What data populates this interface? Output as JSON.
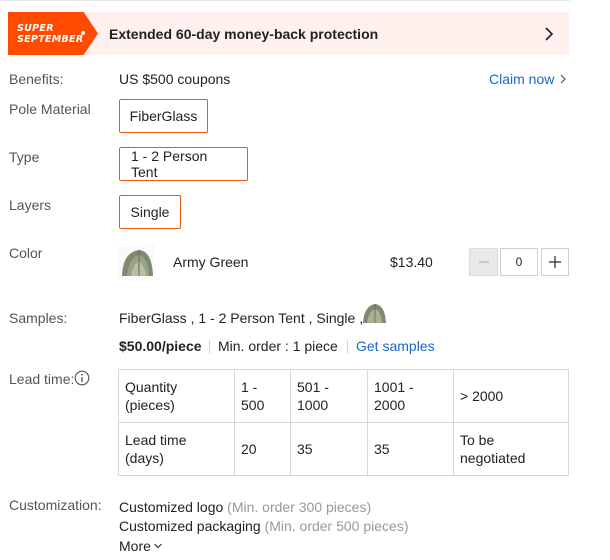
{
  "banner": {
    "badge_line1": "SUPER",
    "badge_line2": "SEPTEMBER",
    "text": "Extended 60-day money-back protection"
  },
  "benefits": {
    "label": "Benefits:",
    "value": "US $500 coupons",
    "claim_label": "Claim now"
  },
  "pole_material": {
    "label": "Pole Material",
    "selected": "FiberGlass"
  },
  "type": {
    "label": "Type",
    "selected": "1 - 2 Person Tent"
  },
  "layers": {
    "label": "Layers",
    "selected": "Single"
  },
  "color": {
    "label": "Color",
    "name": "Army Green",
    "price": "$13.40",
    "quantity": "0"
  },
  "samples": {
    "label": "Samples:",
    "summary": "FiberGlass , 1 - 2 Person Tent , Single ,",
    "price": "$50.00/piece",
    "min_order": "Min. order : 1 piece",
    "get_samples": "Get samples"
  },
  "lead_time": {
    "label": "Lead time:",
    "row1": [
      "Quantity (pieces)",
      "1 - 500",
      "501 - 1000",
      "1001 - 2000",
      "> 2000"
    ],
    "row2": [
      "Lead time (days)",
      "20",
      "35",
      "35",
      "To be negotiated"
    ]
  },
  "customization": {
    "label": "Customization:",
    "items": [
      {
        "name": "Customized logo",
        "note": "(Min. order 300 pieces)"
      },
      {
        "name": "Customized packaging",
        "note": "(Min. order 500 pieces)"
      }
    ],
    "more_label": "More"
  },
  "colors": {
    "accent": "#ff4a00",
    "border_accent": "#e05d10",
    "link": "#1a66c9",
    "banner_bg": "#fff2ee"
  }
}
